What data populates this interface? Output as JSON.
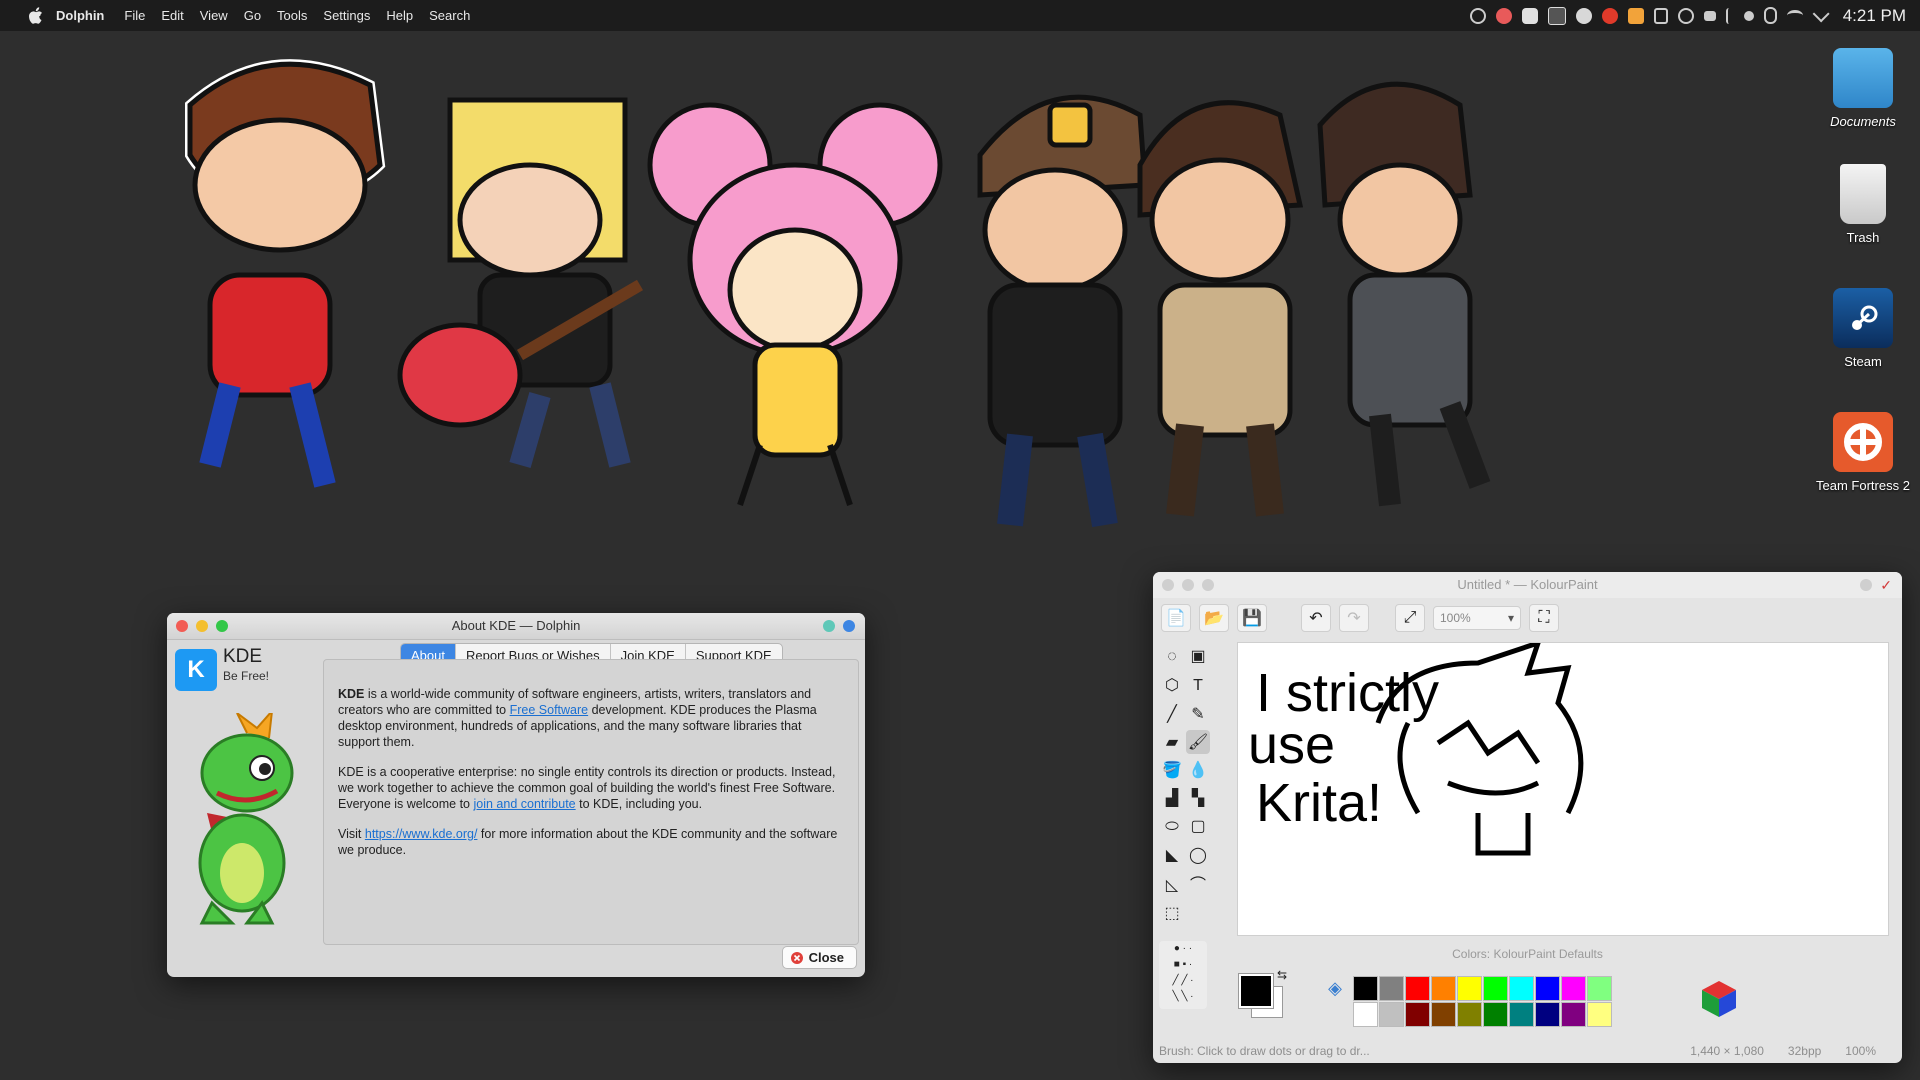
{
  "menubar": {
    "app_name": "Dolphin",
    "items": [
      "File",
      "Edit",
      "View",
      "Go",
      "Tools",
      "Settings",
      "Help",
      "Search"
    ],
    "clock": "4:21 PM"
  },
  "desktop_icons": [
    {
      "label": "Documents",
      "icon": "folder-icon"
    },
    {
      "label": "Trash",
      "icon": "trash-icon"
    },
    {
      "label": "Steam",
      "icon": "steam-icon"
    },
    {
      "label": "Team Fortress 2",
      "icon": "tf2-icon"
    }
  ],
  "about_window": {
    "title": "About KDE — Dolphin",
    "logo_text": "K",
    "app_title": "KDE",
    "tagline": "Be Free!",
    "tabs": [
      {
        "label": "About",
        "active": true
      },
      {
        "label": "Report Bugs or Wishes",
        "active": false
      },
      {
        "label": "Join KDE",
        "active": false
      },
      {
        "label": "Support KDE",
        "active": false
      }
    ],
    "p1_strong": "KDE",
    "p1_a": " is a world-wide community of software engineers, artists, writers, translators and creators who are committed to ",
    "p1_link": "Free Software",
    "p1_b": " development. KDE produces the Plasma desktop environment, hundreds of applications, and the many software libraries that support them.",
    "p2": "KDE is a cooperative enterprise: no single entity controls its direction or products. Instead, we work together to achieve the common goal of building the world's finest Free Software. Everyone is welcome to ",
    "p2_link": "join and contribute",
    "p2_b": " to KDE, including you.",
    "p3_a": "Visit ",
    "p3_link": "https://www.kde.org/",
    "p3_b": " for more information about the KDE community and the software we produce.",
    "close_label": "Close"
  },
  "kolourpaint": {
    "title": "Untitled * — KolourPaint",
    "zoom": "100%",
    "canvas_text_lines": [
      "I strictly",
      "use",
      "Krita!"
    ],
    "colors_label": "Colors: KolourPaint Defaults",
    "palette_top": [
      "#000000",
      "#808080",
      "#ff0000",
      "#ff8000",
      "#ffff00",
      "#00ff00",
      "#00ffff",
      "#0000ff",
      "#ff00ff",
      "#80ff80"
    ],
    "palette_bottom": [
      "#ffffff",
      "#c0c0c0",
      "#800000",
      "#804000",
      "#808000",
      "#008000",
      "#008080",
      "#000080",
      "#800080",
      "#ffff80"
    ],
    "status_hint": "Brush: Click to draw dots or drag to dr...",
    "status_size": "1,440 × 1,080",
    "status_depth": "32bpp",
    "status_zoom": "100%"
  }
}
